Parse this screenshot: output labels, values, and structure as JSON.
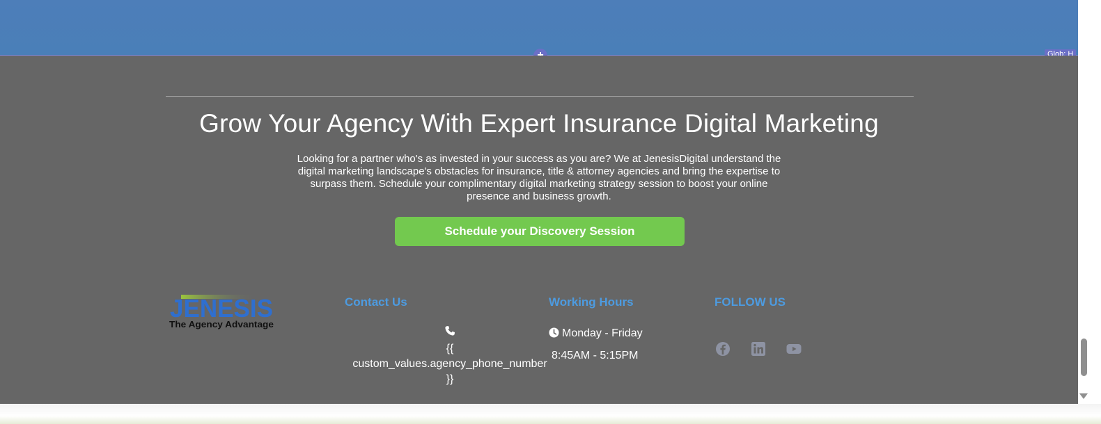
{
  "editor": {
    "add_symbol": "+",
    "global_tag": "Glob: H"
  },
  "cta_section": {
    "headline": "Grow Your Agency With Expert Insurance Digital Marketing",
    "intro": "Looking for a partner who's as invested in your success as you are? We at JenesisDigital understand the digital marketing landscape's obstacles for insurance, title & attorney agencies and bring the expertise to surpass them. Schedule your complimentary digital marketing strategy session to boost your online presence and business growth.",
    "button_label": "Schedule your Discovery Session",
    "button_color": "#73c94f"
  },
  "footer": {
    "logo": {
      "wordmark": "JENESIS",
      "tagline": "The Agency Advantage",
      "brand_color": "#2f6fcf"
    },
    "contact": {
      "title": "Contact Us",
      "icon": "phone-icon",
      "phone_line_1": "{{",
      "phone_line_2": "custom_values.agency_phone_number",
      "phone_line_3": "}}"
    },
    "hours": {
      "title": "Working Hours",
      "icon": "clock-icon",
      "days": "Monday - Friday",
      "time": "8:45AM - 5:15PM"
    },
    "social": {
      "title": "FOLLOW US",
      "icons": [
        "facebook-icon",
        "linkedin-icon",
        "youtube-icon"
      ]
    },
    "heading_color": "#4d9be0",
    "background": "#666666"
  }
}
